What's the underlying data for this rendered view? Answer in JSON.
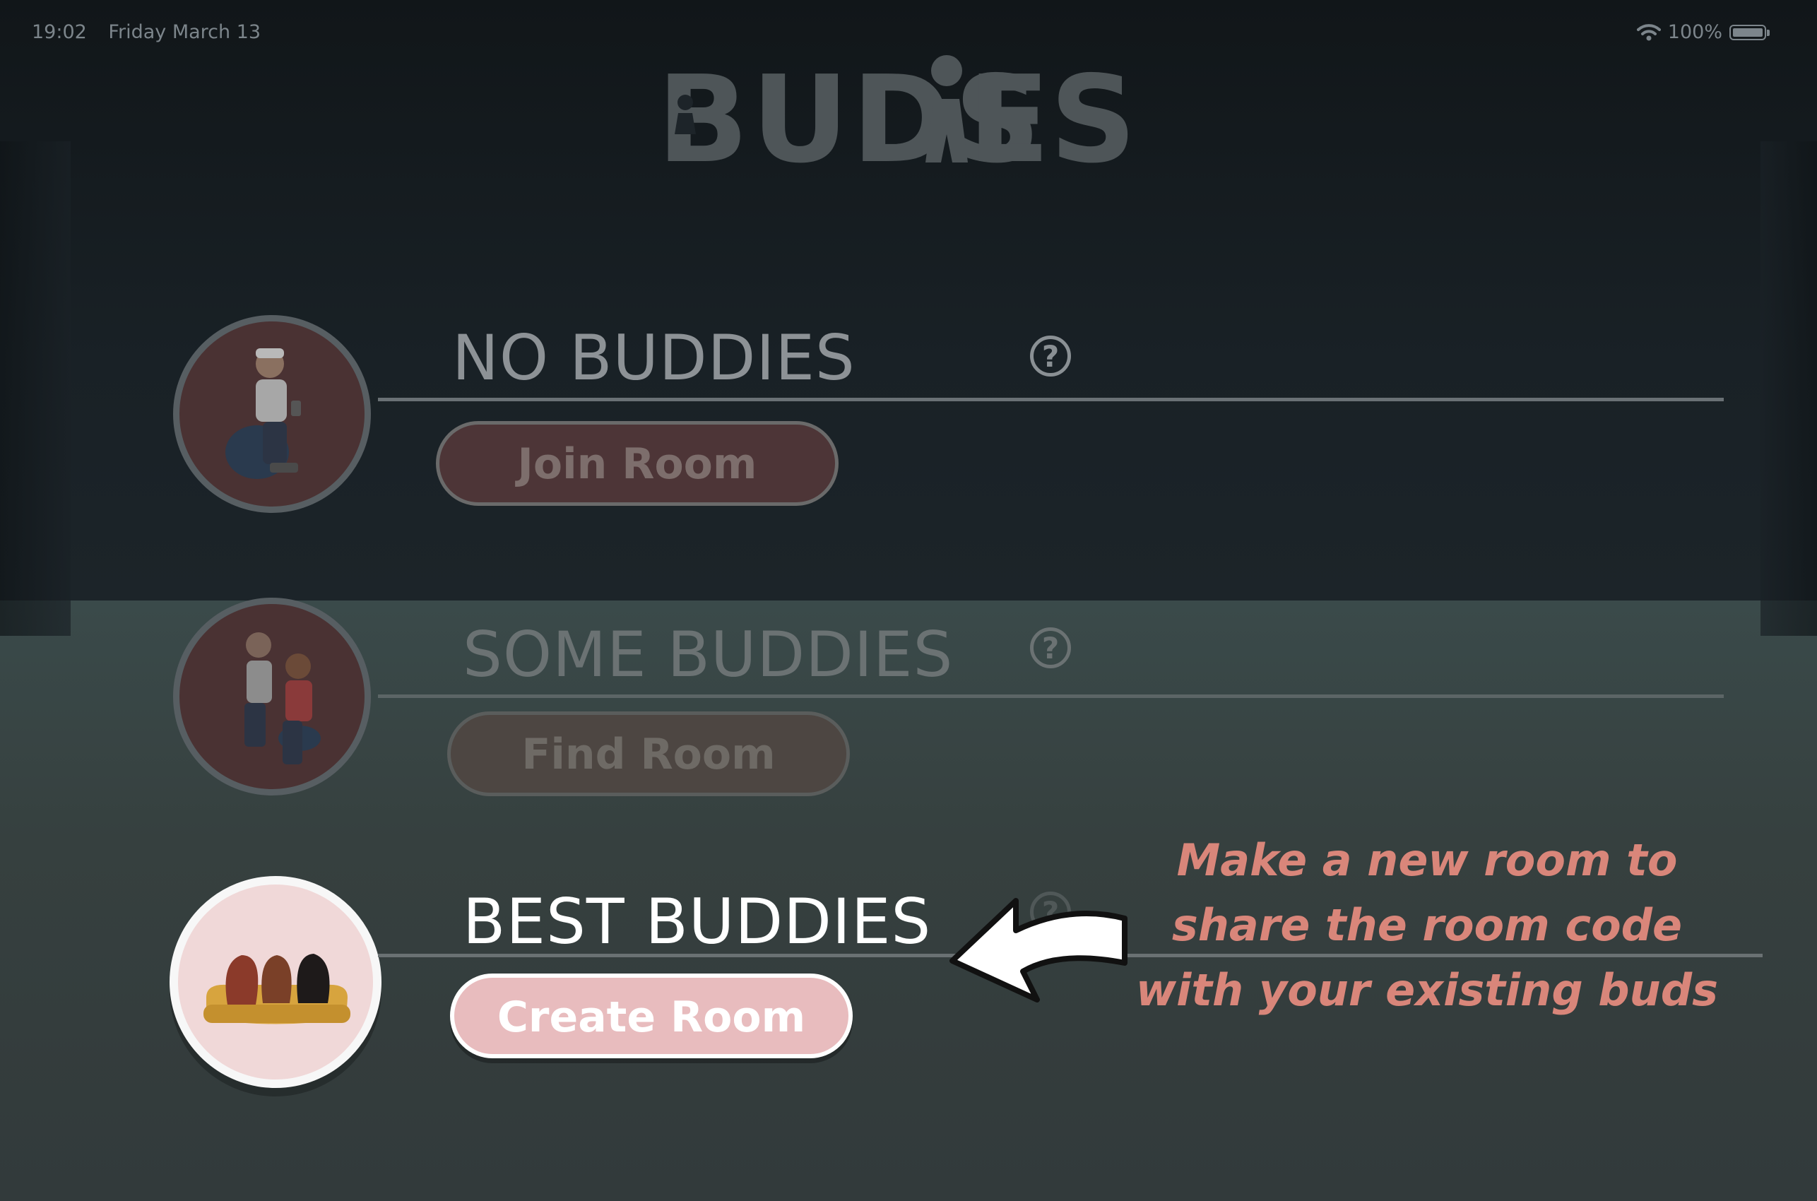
{
  "status_bar": {
    "time": "19:02",
    "date": "Friday March 13",
    "battery": "100%",
    "icons": [
      "wifi-icon",
      "battery-icon"
    ]
  },
  "app": {
    "logo_text": "BUDSiES"
  },
  "rooms": [
    {
      "title": "NO BUDDIES",
      "button": "Join Room",
      "help": "?",
      "illustration": "person-on-beanbag-icon"
    },
    {
      "title": "SOME BUDDIES",
      "button": "Find Room",
      "help": "?",
      "illustration": "two-friends-icon"
    },
    {
      "title": "BEST BUDDIES",
      "button": "Create Room",
      "help": "?",
      "illustration": "friends-on-couch-icon"
    }
  ],
  "annotation": {
    "line1": "Make a new room to",
    "line2": "share the room code",
    "line3": "with your existing buds"
  },
  "colors": {
    "accent_pink": "#e8bcbe",
    "annotation": "#d9867a",
    "background": "#1d2429"
  }
}
